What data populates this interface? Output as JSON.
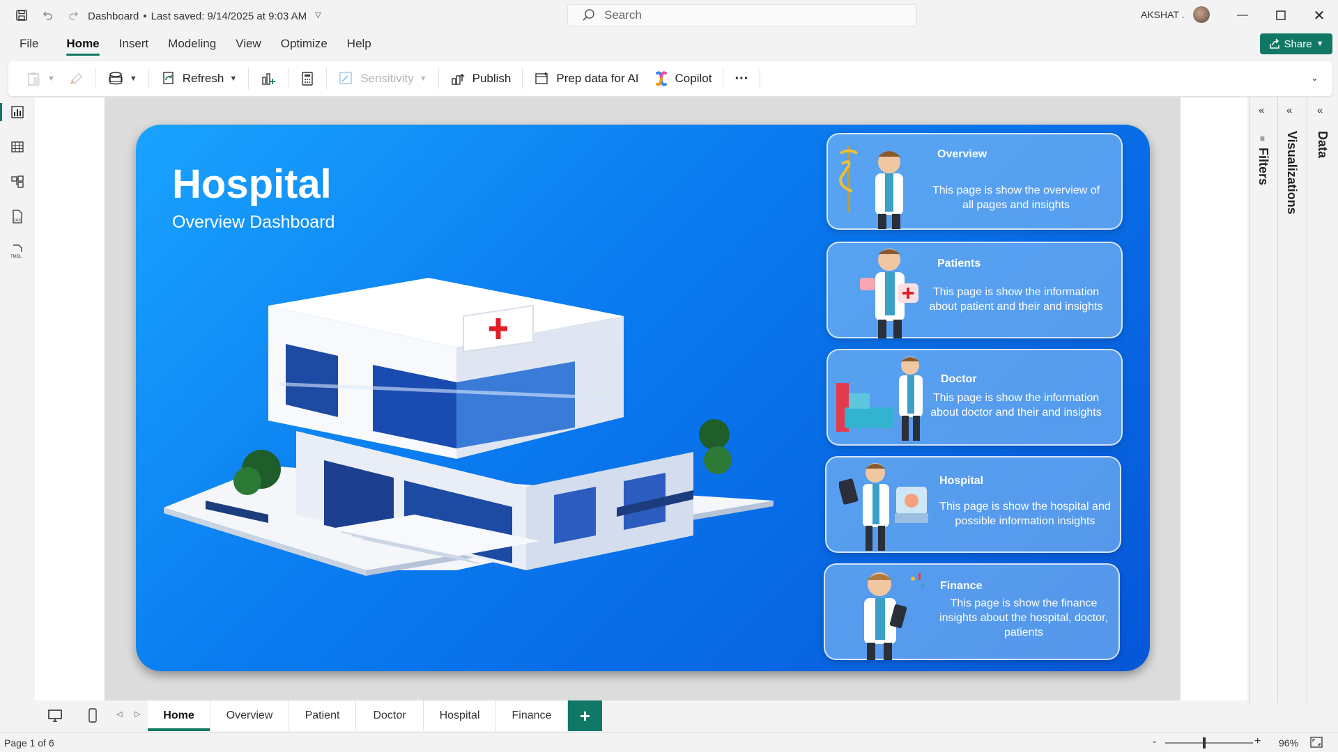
{
  "titlebar": {
    "doc_name": "Dashboard",
    "saved": "Last saved: 9/14/2025 at 9:03 AM",
    "search_placeholder": "Search",
    "user": "AKSHAT ."
  },
  "menu": {
    "items": [
      "File",
      "Home",
      "Insert",
      "Modeling",
      "View",
      "Optimize",
      "Help"
    ],
    "active": "Home",
    "share": "Share"
  },
  "ribbon": {
    "refresh": "Refresh",
    "sensitivity": "Sensitivity",
    "publish": "Publish",
    "prep_ai": "Prep data for AI",
    "copilot": "Copilot",
    "more": "···"
  },
  "report": {
    "title": "Hospital",
    "subtitle": "Overview Dashboard",
    "cards": [
      {
        "title": "Overview",
        "desc": "This page is show the overview of all pages and insights"
      },
      {
        "title": "Patients",
        "desc": "This page is show the information about patient and their and insights"
      },
      {
        "title": "Doctor",
        "desc": "This page is show the information about doctor and their and insights"
      },
      {
        "title": "Hospital",
        "desc": "This page is show the hospital and possible information insights"
      },
      {
        "title": "Finance",
        "desc": "This page is show the finance insights about the hospital, doctor, patients"
      }
    ]
  },
  "panels": {
    "filters": "Filters",
    "visualizations": "Visualizations",
    "data": "Data"
  },
  "tabs": [
    "Home",
    "Overview",
    "Patient",
    "Doctor",
    "Hospital",
    "Finance"
  ],
  "status": {
    "page": "Page 1 of 6",
    "zoom": "96%"
  },
  "colors": {
    "accent": "#117865",
    "report_blue": "#0a7cf0"
  }
}
